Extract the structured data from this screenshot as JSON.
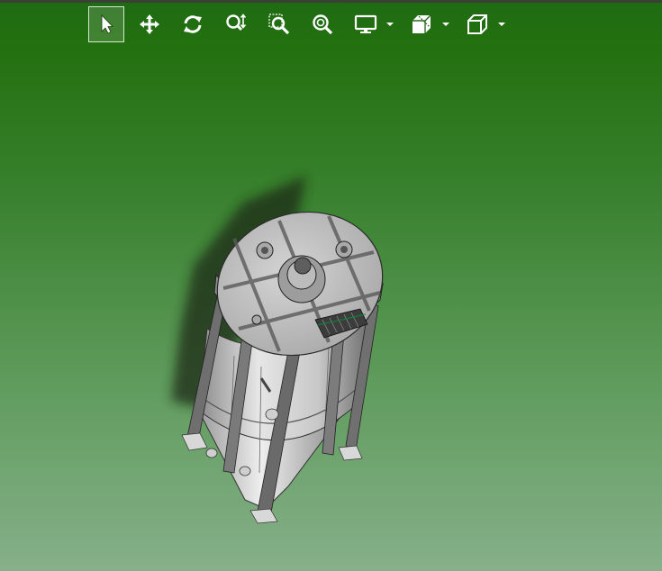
{
  "viewer": {
    "background_top": "#1f6b14",
    "background_bottom": "#86b08a",
    "icon_color": "#ffffff"
  },
  "toolbar": {
    "tools": [
      {
        "name": "select",
        "icon": "cursor-arrow-icon",
        "active": true
      },
      {
        "name": "pan",
        "icon": "move-arrows-icon",
        "active": false
      },
      {
        "name": "rotate",
        "icon": "rotate-icon",
        "active": false
      },
      {
        "name": "zoom",
        "icon": "zoom-icon",
        "active": false
      },
      {
        "name": "zoom-window",
        "icon": "zoom-window-icon",
        "active": false
      },
      {
        "name": "zoom-fit",
        "icon": "zoom-fit-icon",
        "active": false
      },
      {
        "name": "display",
        "icon": "monitor-icon",
        "has_dropdown": true
      },
      {
        "name": "section",
        "icon": "section-cube-icon",
        "has_dropdown": true
      },
      {
        "name": "standard-views",
        "icon": "view-cube-icon",
        "has_dropdown": true
      }
    ]
  },
  "model": {
    "description_icon": "tank-assembly-3d-model"
  }
}
